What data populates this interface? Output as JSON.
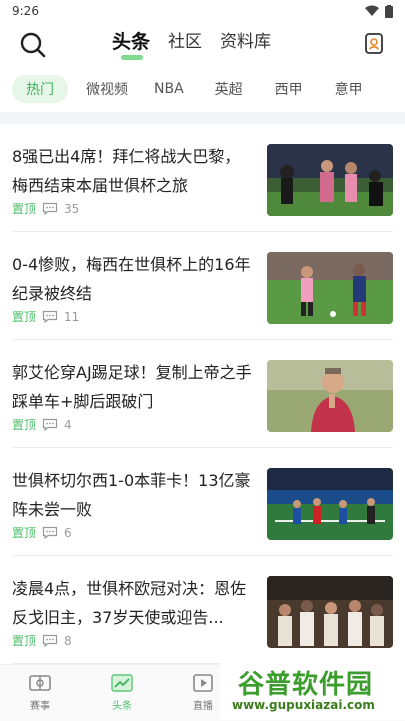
{
  "status": {
    "time": "9:26"
  },
  "header": {
    "tabs": [
      {
        "label": "头条"
      },
      {
        "label": "社区"
      },
      {
        "label": "资料库"
      }
    ]
  },
  "sub_tabs": [
    {
      "label": "热门"
    },
    {
      "label": "微视频"
    },
    {
      "label": "NBA"
    },
    {
      "label": "英超"
    },
    {
      "label": "西甲"
    },
    {
      "label": "意甲"
    }
  ],
  "news": [
    {
      "title": "8强已出4席！拜仁将战大巴黎，梅西结束本届世俱杯之旅",
      "tag": "置顶",
      "comments": "35"
    },
    {
      "title": "0-4惨败，梅西在世俱杯上的16年纪录被终结",
      "tag": "置顶",
      "comments": "11"
    },
    {
      "title": "郭艾伦穿AJ踢足球！复制上帝之手 踩单车+脚后跟破门",
      "tag": "置顶",
      "comments": "4"
    },
    {
      "title": "世俱杯切尔西1-0本菲卡！13亿豪阵未尝一败",
      "tag": "置顶",
      "comments": "6"
    },
    {
      "title": "凌晨4点，世俱杯欧冠对决：恩佐反戈旧主，37岁天使或迎告...",
      "tag": "置顶",
      "comments": "8"
    }
  ],
  "bottom_nav": [
    {
      "label": "赛事"
    },
    {
      "label": "头条"
    },
    {
      "label": "直播"
    }
  ],
  "watermark": {
    "title": "谷普软件园",
    "url": "www.gupuxiazai.com"
  }
}
